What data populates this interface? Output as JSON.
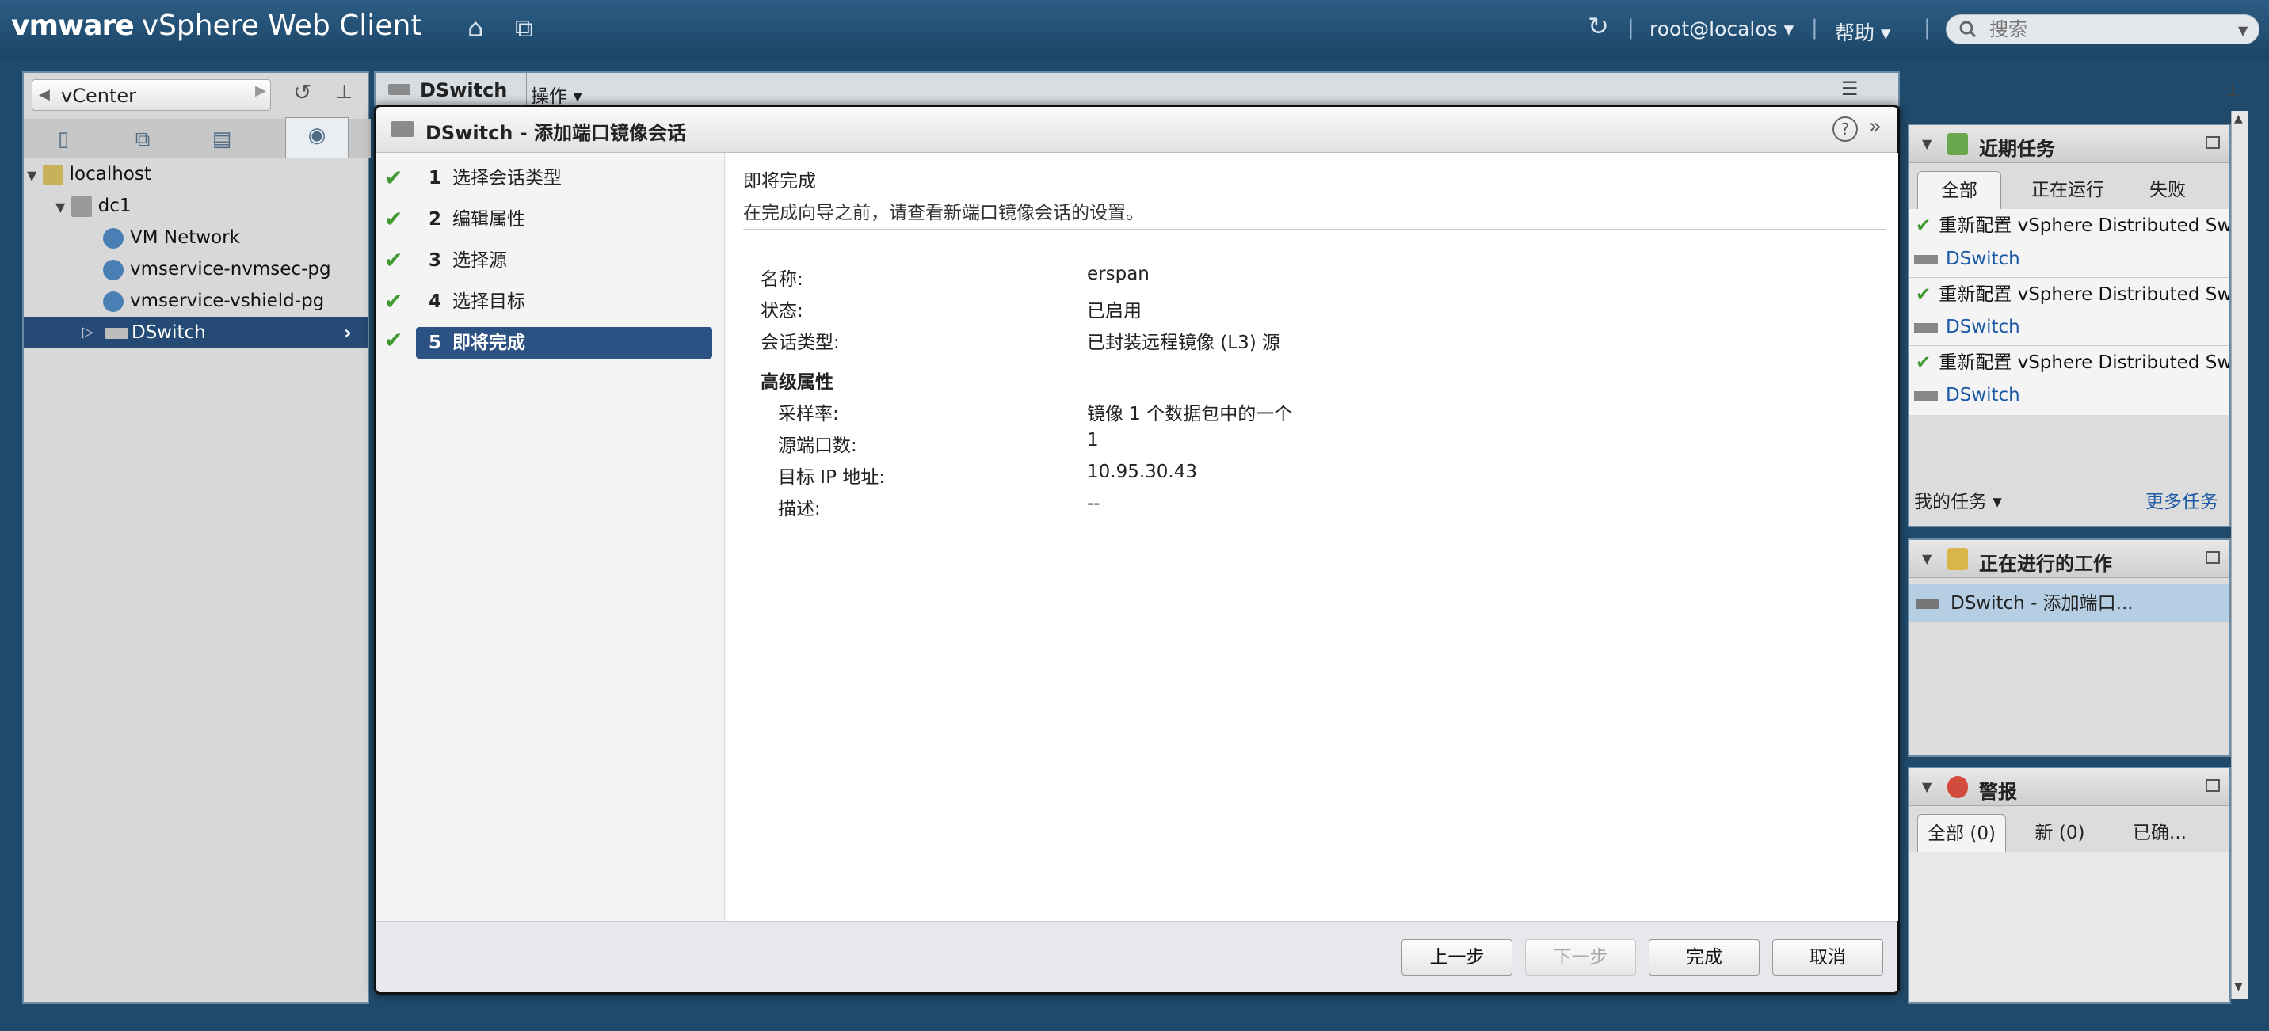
{
  "header": {
    "brand": "vmware",
    "product": "vSphere Web Client",
    "user": "root@localos",
    "help": "帮助",
    "search_placeholder": "搜索"
  },
  "nav": {
    "back_label": "vCenter",
    "tree": [
      {
        "label": "localhost",
        "level": 0,
        "icon": "datacenter-folder-icon"
      },
      {
        "label": "dc1",
        "level": 1,
        "icon": "datacenter-icon"
      },
      {
        "label": "VM Network",
        "level": 2,
        "icon": "network-icon"
      },
      {
        "label": "vmservice-nvmsec-pg",
        "level": 2,
        "icon": "network-icon"
      },
      {
        "label": "vmservice-vshield-pg",
        "level": 2,
        "icon": "network-icon"
      },
      {
        "label": "DSwitch",
        "level": 2,
        "icon": "dswitch-icon",
        "selected": true
      }
    ]
  },
  "center": {
    "tab": "DSwitch",
    "actions": "操作"
  },
  "dialog": {
    "title": "DSwitch - 添加端口镜像会话",
    "steps": [
      {
        "num": "1",
        "label": "选择会话类型"
      },
      {
        "num": "2",
        "label": "编辑属性"
      },
      {
        "num": "3",
        "label": "选择源"
      },
      {
        "num": "4",
        "label": "选择目标"
      },
      {
        "num": "5",
        "label": "即将完成",
        "current": true
      }
    ],
    "content_title": "即将完成",
    "content_subtitle": "在完成向导之前，请查看新端口镜像会话的设置。",
    "summary": [
      {
        "key": "名称:",
        "value": "erspan"
      },
      {
        "key": "状态:",
        "value": "已启用"
      },
      {
        "key": "会话类型:",
        "value": "已封装远程镜像 (L3) 源"
      }
    ],
    "advanced_header": "高级属性",
    "advanced": [
      {
        "key": "采样率:",
        "value": "镜像 1 个数据包中的一个"
      },
      {
        "key": "源端口数:",
        "value": "1"
      },
      {
        "key": "目标 IP 地址:",
        "value": "10.95.30.43"
      },
      {
        "key": "描述:",
        "value": "--"
      }
    ],
    "buttons": {
      "back": "上一步",
      "next": "下一步",
      "finish": "完成",
      "cancel": "取消"
    }
  },
  "recent_tasks": {
    "title": "近期任务",
    "tabs": [
      "全部",
      "正在运行",
      "失败"
    ],
    "items": [
      {
        "task": "重新配置 vSphere Distributed Switch",
        "target": "DSwitch"
      },
      {
        "task": "重新配置 vSphere Distributed Switch",
        "target": "DSwitch"
      },
      {
        "task": "重新配置 vSphere Distributed Switch",
        "target": "DSwitch"
      }
    ],
    "my_tasks": "我的任务",
    "more_tasks": "更多任务"
  },
  "work_in_progress": {
    "title": "正在进行的工作",
    "items": [
      "DSwitch - 添加端口..."
    ]
  },
  "alarms": {
    "title": "警报",
    "tabs": [
      "全部 (0)",
      "新 (0)",
      "已确..."
    ]
  },
  "colors": {
    "header_bg": "#1c4566",
    "selection": "#244a75",
    "check_green": "#3f9a2f",
    "link_blue": "#1d5aa6"
  }
}
